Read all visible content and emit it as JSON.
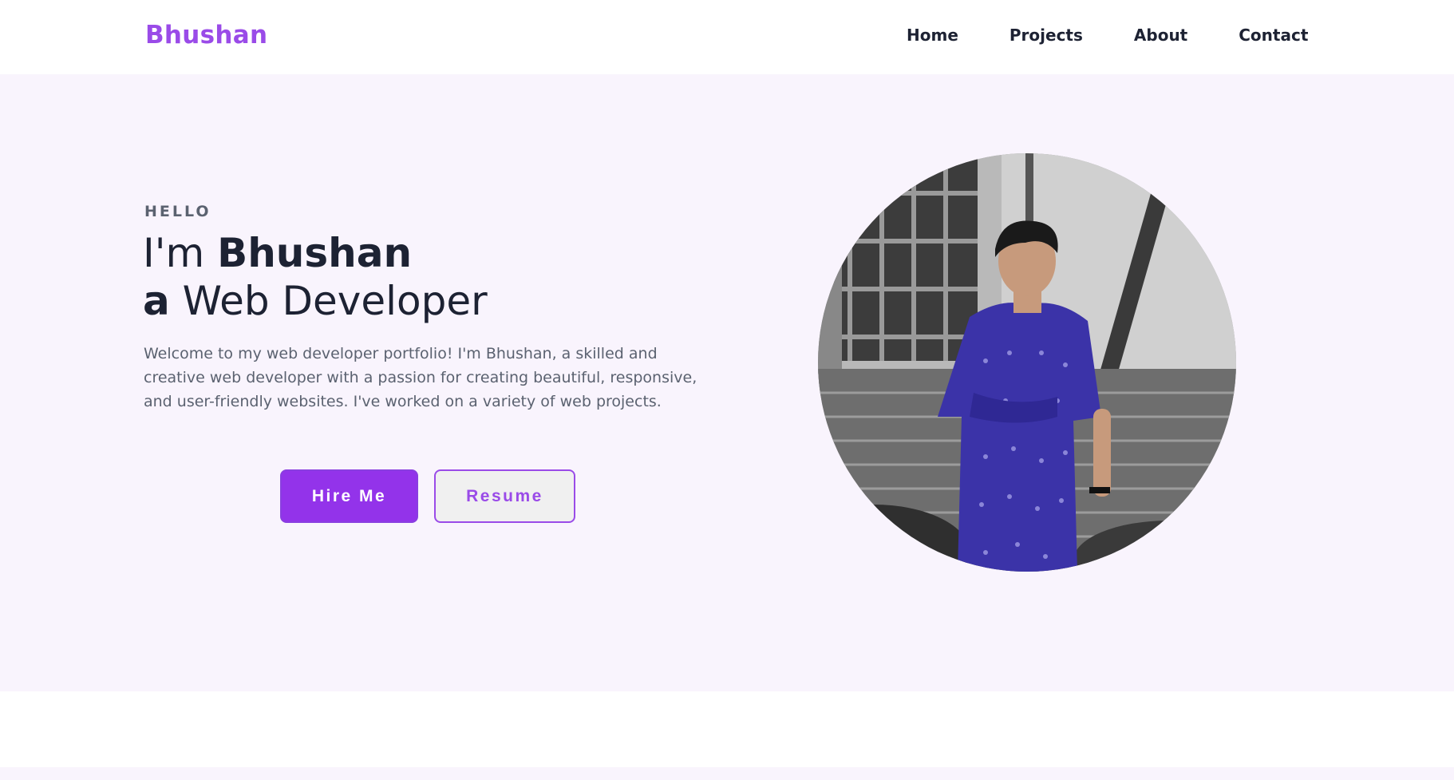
{
  "brand": {
    "name": "Bhushan",
    "accent_color": "#9a4be8",
    "button_color": "#9333ea"
  },
  "nav": {
    "items": [
      "Home",
      "Projects",
      "About",
      "Contact"
    ]
  },
  "hero": {
    "eyebrow": "HELLO",
    "headline_prefix": "I'm ",
    "headline_name": "Bhushan",
    "headline_line2_a": "a",
    "headline_line2_rest": " Web Developer",
    "intro": "Welcome to my web developer portfolio! I'm Bhushan, a skilled and creative web developer with a passion for creating beautiful, responsive, and user-friendly websites. I've worked on a variety of web projects.",
    "primary_button": "Hire Me",
    "secondary_button": "Resume"
  },
  "portrait": {
    "icon": "profile-photo"
  }
}
